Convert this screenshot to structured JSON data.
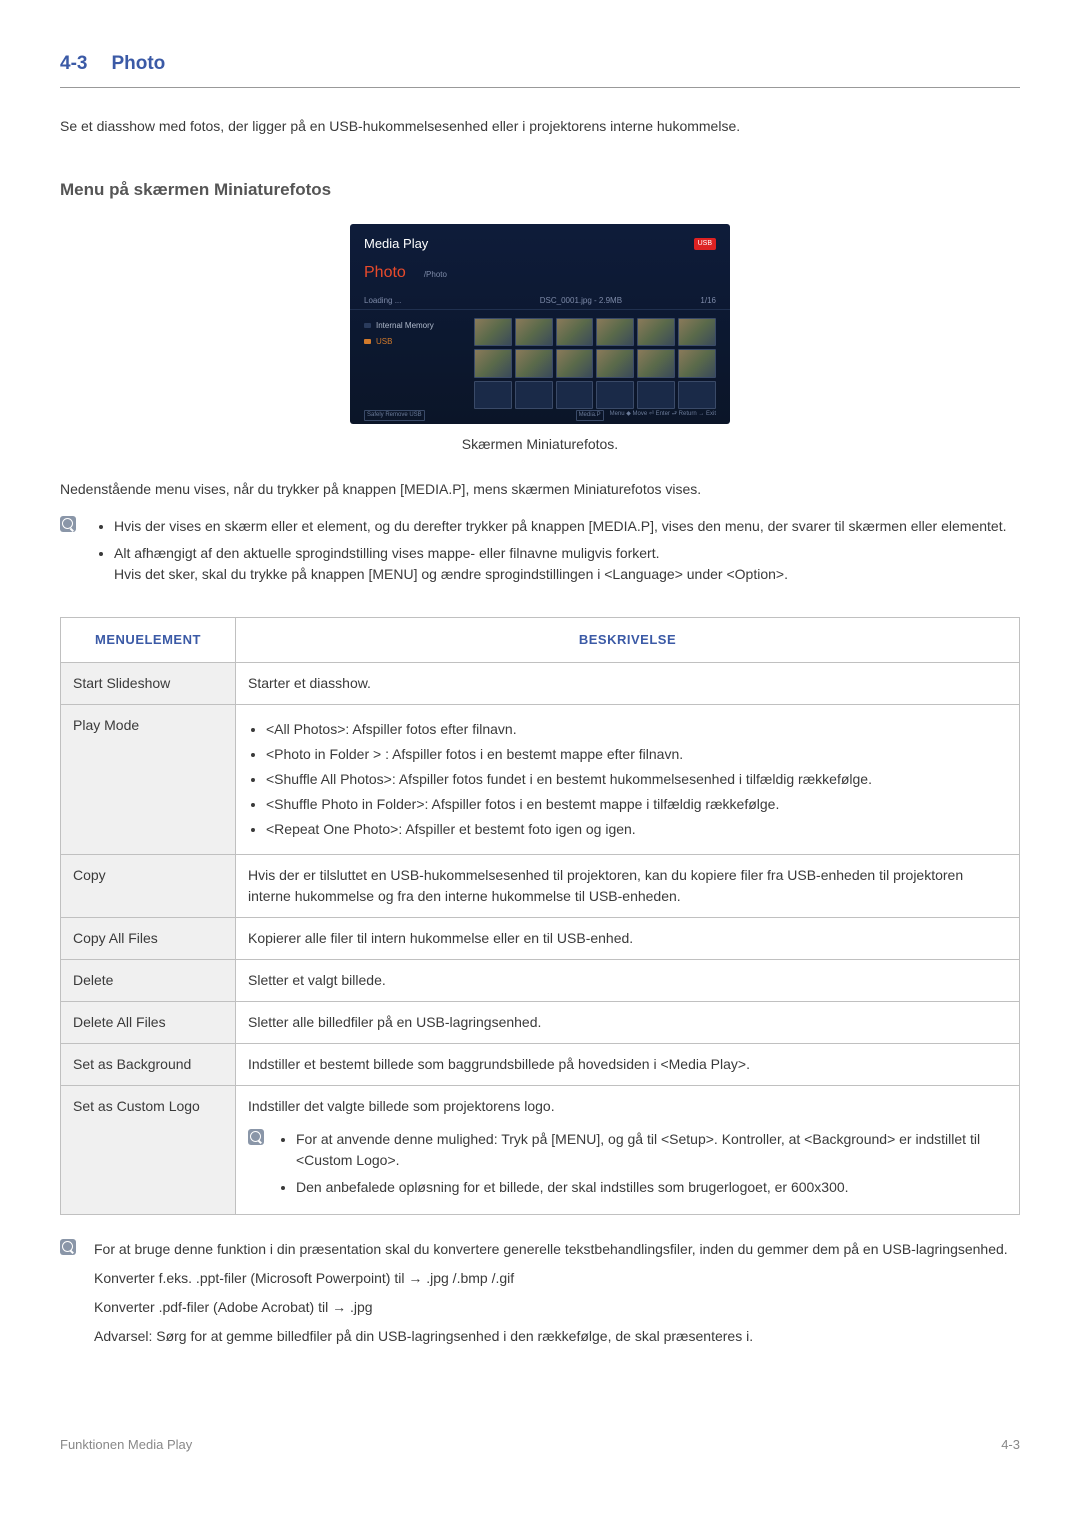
{
  "section": {
    "number": "4-3",
    "title": "Photo"
  },
  "intro": "Se et diasshow med fotos, der ligger på en USB-hukommelsesenhed eller i projektorens interne hukommelse.",
  "subsection_title": "Menu på skærmen Miniaturefotos",
  "screenshot": {
    "media_play": "Media Play",
    "usb_badge": "USB",
    "photo_label": "Photo",
    "breadcrumb": "/Photo",
    "loading": "Loading ...",
    "filename": "DSC_0001.jpg - 2.9MB",
    "count": "1/16",
    "storage": {
      "internal": "Internal Memory",
      "usb": "USB"
    },
    "footer": {
      "safely_remove": "Safely Remove USB",
      "media_p": "Media.P",
      "menu_hint": "Menu ◆ Move ⏎ Enter ⮐ Return → Exit"
    },
    "caption": "Skærmen Miniaturefotos."
  },
  "pre_table": "Nedenstående menu vises, når du trykker på knappen [MEDIA.P], mens skærmen Miniaturefotos vises.",
  "note1": {
    "item1": "Hvis der vises en skærm eller et element, og du derefter trykker på knappen [MEDIA.P], vises den menu, der svarer til skærmen eller elementet.",
    "item2a": "Alt afhængigt af den aktuelle sprogindstilling vises mappe- eller filnavne muligvis forkert.",
    "item2b": "Hvis det sker, skal du trykke på knappen [MENU] og ændre sprogindstillingen i <Language> under <Option>."
  },
  "table": {
    "header_menu": "MENUELEMENT",
    "header_desc": "BESKRIVELSE",
    "rows": {
      "start_slideshow": {
        "label": "Start Slideshow",
        "desc": "Starter et diasshow."
      },
      "play_mode": {
        "label": "Play Mode",
        "items": {
          "0": "<All Photos>: Afspiller fotos efter filnavn.",
          "1": "<Photo in Folder > : Afspiller fotos i en bestemt mappe efter filnavn.",
          "2": "<Shuffle All Photos>: Afspiller fotos fundet i en bestemt hukommelsesenhed i tilfældig rækkefølge.",
          "3": "<Shuffle Photo in Folder>: Afspiller fotos i en bestemt mappe i tilfældig rækkefølge.",
          "4": "<Repeat One Photo>: Afspiller et bestemt foto igen og igen."
        }
      },
      "copy": {
        "label": "Copy",
        "desc": "Hvis der er tilsluttet en USB-hukommelsesenhed til projektoren, kan du kopiere filer fra USB-enheden til projektoren interne hukommelse og fra den interne hukommelse til USB-enheden."
      },
      "copy_all": {
        "label": "Copy All Files",
        "desc": "Kopierer alle filer til intern hukommelse eller en til USB-enhed."
      },
      "delete": {
        "label": "Delete",
        "desc": "Sletter et valgt billede."
      },
      "delete_all": {
        "label": "Delete All Files",
        "desc": "Sletter alle billedfiler på en USB-lagringsenhed."
      },
      "set_background": {
        "label": "Set as Background",
        "desc": "Indstiller et bestemt billede som baggrundsbillede på hovedsiden i <Media Play>."
      },
      "set_custom_logo": {
        "label": "Set as Custom Logo",
        "desc": "Indstiller det valgte billede som projektorens logo.",
        "note_items": {
          "0": "For at anvende denne mulighed: Tryk på [MENU], og gå til <Setup>. Kontroller, at <Background> er indstillet til <Custom Logo>.",
          "1": "Den anbefalede opløsning for et billede, der skal indstilles som brugerlogoet, er 600x300."
        }
      }
    }
  },
  "final_note": {
    "p0": "For at bruge denne funktion i din præsentation skal du konvertere generelle tekstbehandlingsfiler, inden du gemmer dem på en USB-lagringsenhed.",
    "p1": "Konverter f.eks. .ppt-filer (Microsoft Powerpoint) til → .jpg /.bmp /.gif",
    "p2": "Konverter .pdf-filer (Adobe Acrobat) til → .jpg",
    "p3": "Advarsel: Sørg for at gemme billedfiler på din USB-lagringsenhed i den rækkefølge, de skal præsenteres i."
  },
  "footer": {
    "left": "Funktionen Media Play",
    "right": "4-3"
  }
}
